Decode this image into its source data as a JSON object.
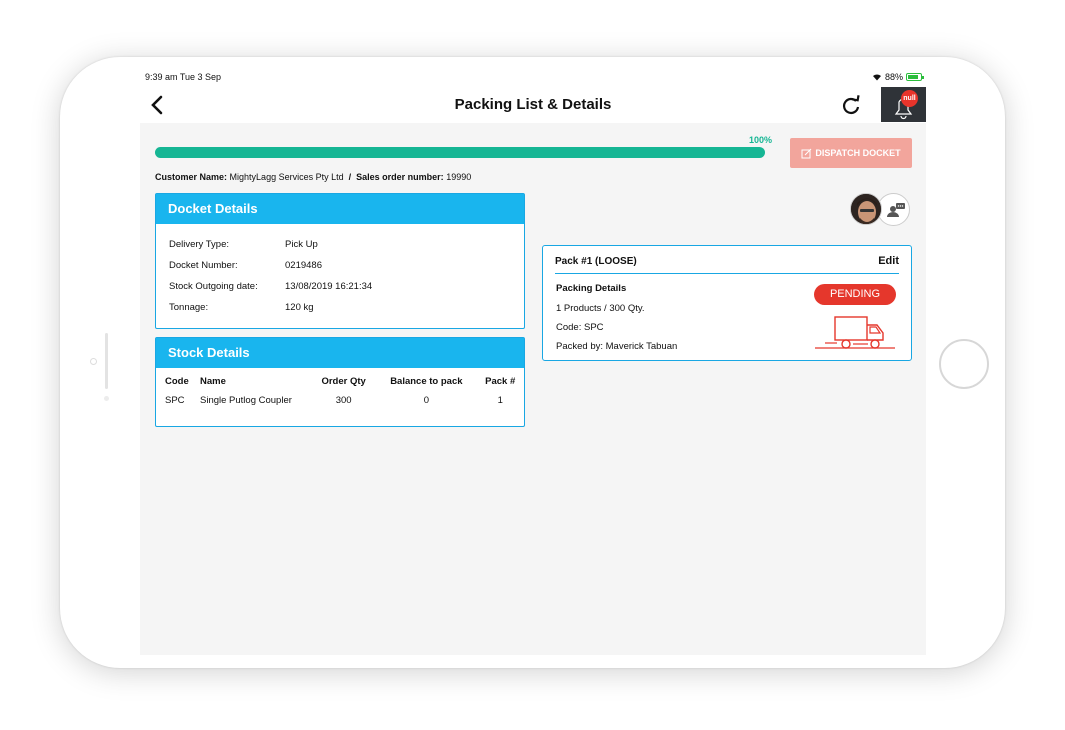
{
  "status_bar": {
    "time": "9:39 am  Tue 3 Sep",
    "battery": "88%"
  },
  "nav": {
    "back_icon": "chevron-left-icon",
    "title": "Packing List & Details",
    "refresh_icon": "refresh-icon",
    "notification_badge": "null"
  },
  "progress": {
    "percent_label": "100%",
    "value": 1.0,
    "color": "#16b694"
  },
  "dispatch_button": {
    "label": "DISPATCH DOCKET",
    "color": "#f2a59c"
  },
  "customer": {
    "name_label": "Customer Name:",
    "name_value": "MightyLagg Services Pty Ltd",
    "separator": "/",
    "order_label": "Sales order number:",
    "order_value": "19990"
  },
  "docket": {
    "title": "Docket Details",
    "rows": [
      {
        "label": "Delivery Type:",
        "value": "Pick Up"
      },
      {
        "label": "Docket Number:",
        "value": "0219486"
      },
      {
        "label": "Stock Outgoing date:",
        "value": "13/08/2019 16:21:34"
      },
      {
        "label": "Tonnage:",
        "value": "120 kg"
      }
    ]
  },
  "stock": {
    "title": "Stock Details",
    "columns": [
      "Code",
      "Name",
      "Order Qty",
      "Balance to pack",
      "Pack #"
    ],
    "rows": [
      {
        "code": "SPC",
        "name": "Single Putlog Coupler",
        "order_qty": "300",
        "balance": "0",
        "pack": "1"
      }
    ]
  },
  "pack": {
    "title": "Pack #1 (LOOSE)",
    "edit_label": "Edit",
    "details_label": "Packing Details",
    "products_line": "1 Products / 300 Qty.",
    "code_line": "Code: SPC",
    "packed_by_line": "Packed by: Maverick Tabuan",
    "status": "PENDING",
    "status_color": "#e5372c"
  },
  "accent_color": "#19b5ee"
}
